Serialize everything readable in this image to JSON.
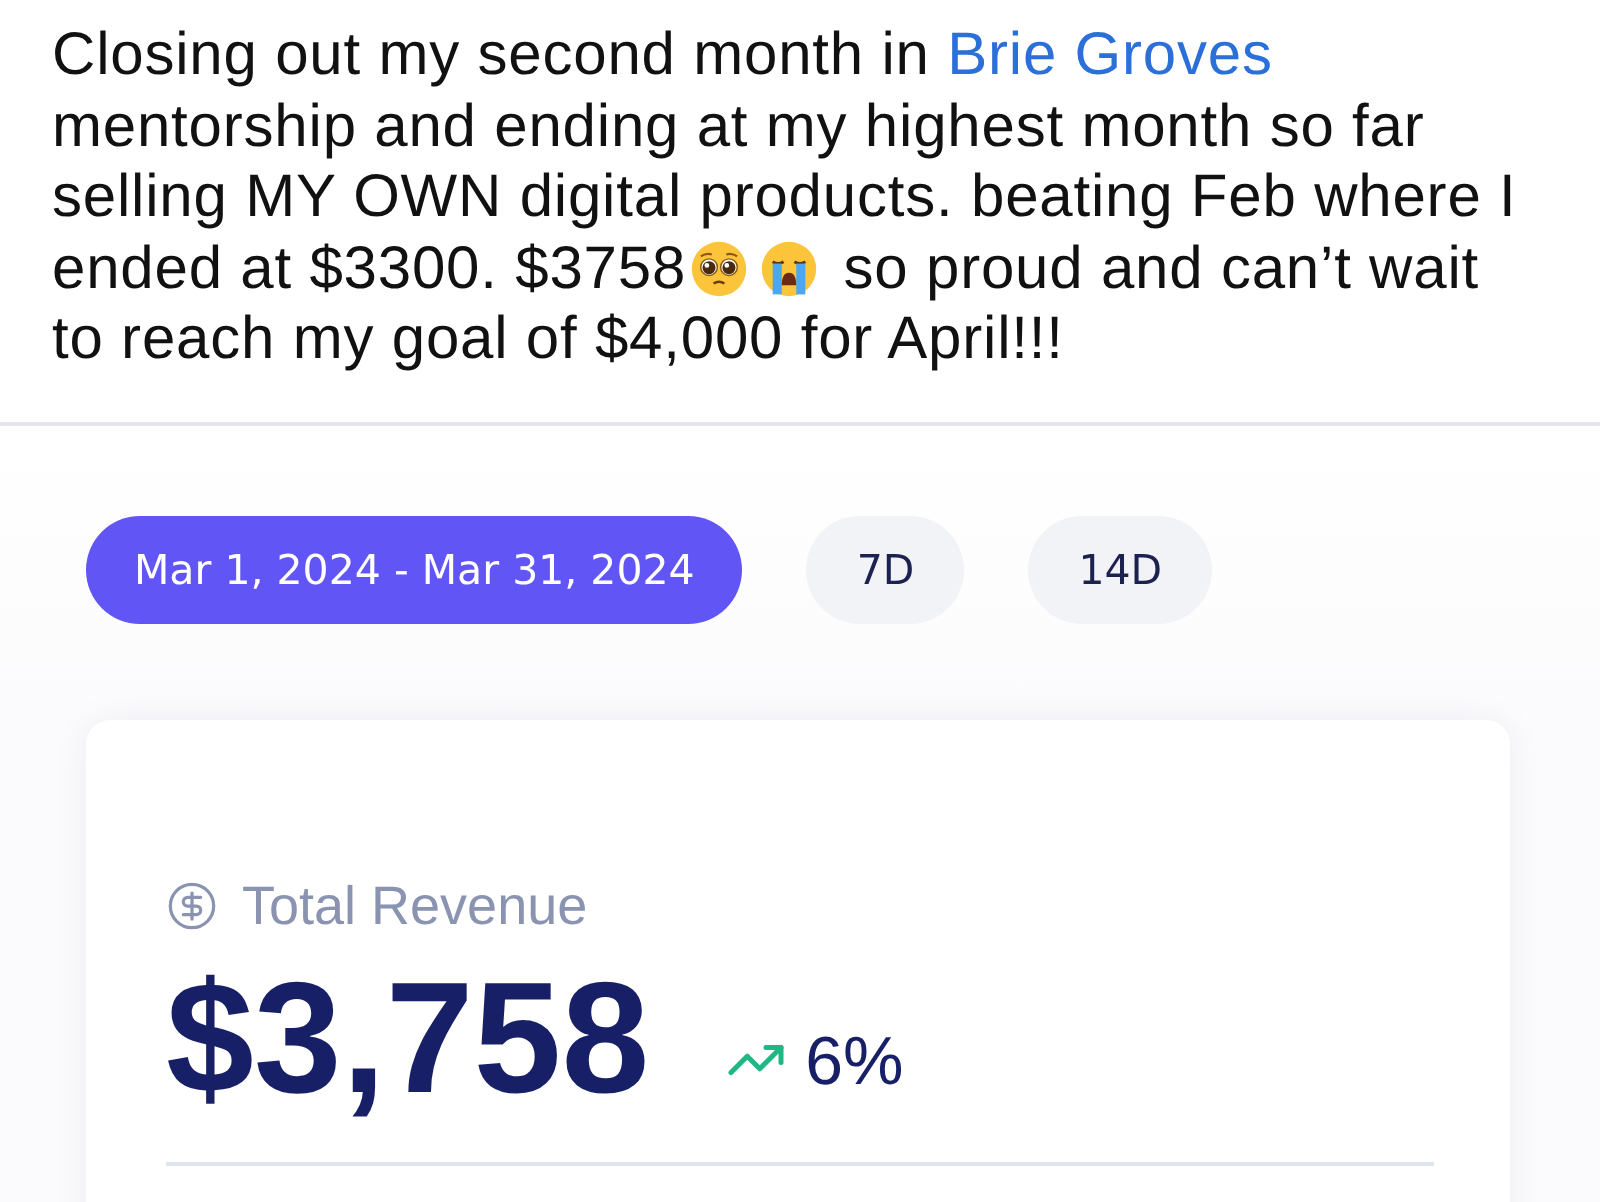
{
  "post": {
    "text_before": "Closing out my second month in ",
    "link": "Brie Groves",
    "text_middle": " mentorship and ending at my highest month so far selling MY OWN digital products. beating Feb where I ended at $3300. $3758",
    "text_after": " so proud and can’t wait to reach my goal of $4,000 for April!!!"
  },
  "filters": [
    {
      "label": "Mar 1, 2024 - Mar 31, 2024",
      "selected": true
    },
    {
      "label": "7D",
      "selected": false
    },
    {
      "label": "14D",
      "selected": false
    }
  ],
  "metric": {
    "label": "Total Revenue",
    "value": "$3,758",
    "change": "6%",
    "trending_up": true
  }
}
